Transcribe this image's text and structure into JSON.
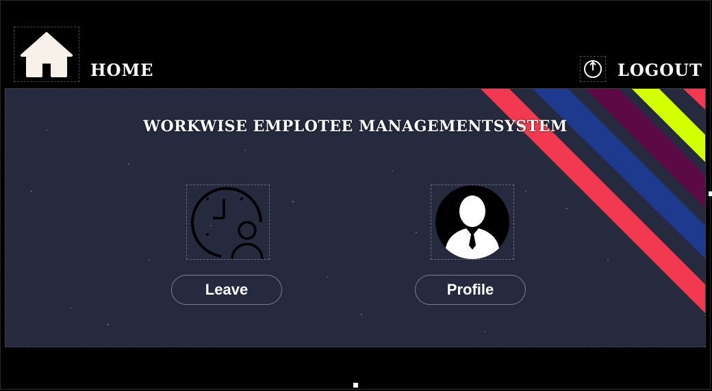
{
  "header": {
    "home_label": "HOME",
    "logout_label": "LOGOUT",
    "home_icon": "home-icon",
    "logout_icon": "power-icon"
  },
  "main": {
    "title": "WORKWISE EMPLOTEE MANAGEMENTSYSTEM",
    "leave_label": "Leave",
    "profile_label": "Profile",
    "leave_icon": "clock-user-icon",
    "profile_icon": "user-avatar-icon"
  },
  "colors": {
    "panel_background": "#252a3e",
    "stripe_red": "#f2394f",
    "stripe_blue": "#1d3a8f",
    "stripe_purple": "#5c0a45",
    "stripe_lime": "#d4ff00"
  }
}
